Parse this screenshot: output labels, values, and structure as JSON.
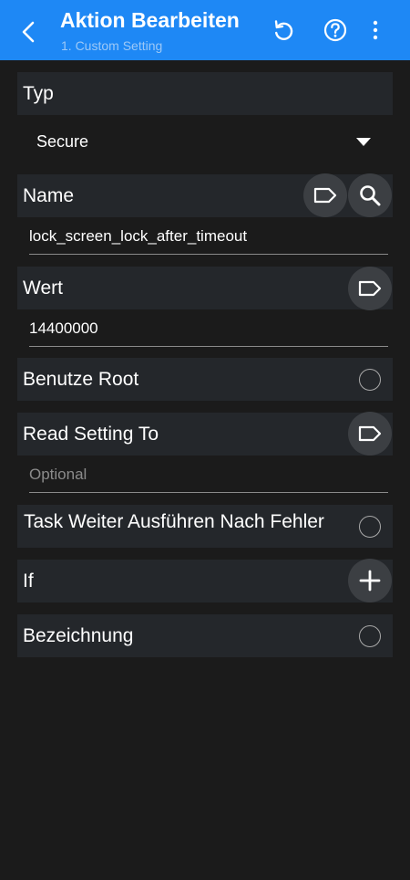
{
  "appbar": {
    "title": "Aktion Bearbeiten",
    "subtitle": "1. Custom Setting",
    "icons": [
      "back-arrow-icon",
      "undo-icon",
      "help-icon",
      "more-vert-icon"
    ]
  },
  "type_section": {
    "label": "Typ",
    "selected": "Secure"
  },
  "name_section": {
    "label": "Name",
    "value": "lock_screen_lock_after_timeout"
  },
  "value_section": {
    "label": "Wert",
    "value": "14400000"
  },
  "use_root": {
    "label": "Benutze Root"
  },
  "read_setting": {
    "label": "Read Setting To",
    "placeholder": "Optional"
  },
  "continue_task": {
    "label": "Task Weiter Ausführen Nach Fehler"
  },
  "if_section": {
    "label": "If"
  },
  "label_section": {
    "label": "Bezeichnung"
  },
  "colors": {
    "appbar": "#1e88f5",
    "background": "#1b1b1b",
    "row": "#24272b",
    "button": "#3c3f43"
  }
}
